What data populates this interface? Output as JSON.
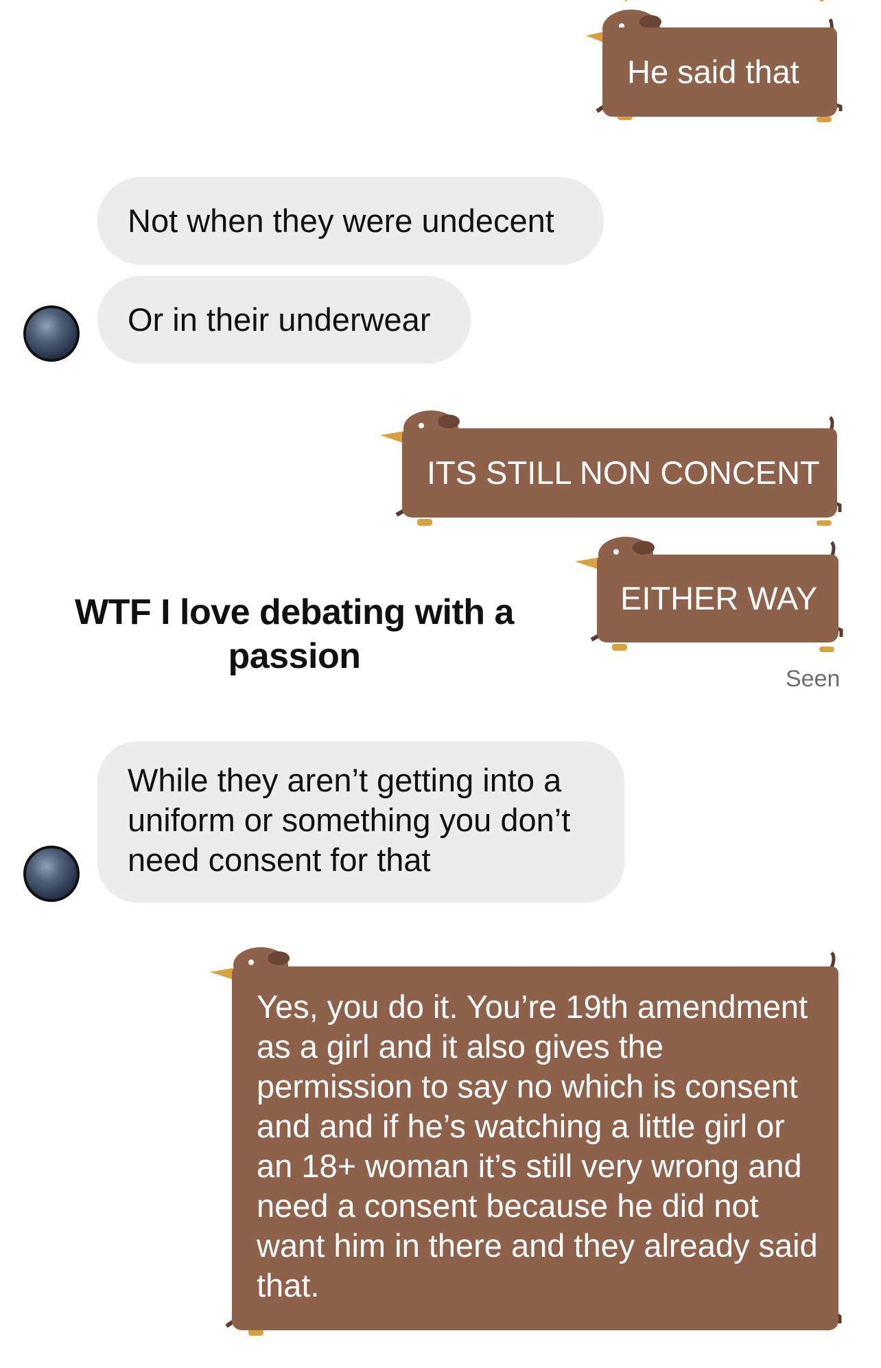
{
  "messages": {
    "m1": "He said that",
    "m2": "Not when they were undecent",
    "m3": "Or in their underwear",
    "m4": "ITS STILL NON CONCENT",
    "m5": "EITHER WAY",
    "m6": "While they aren’t getting into a uniform or something you don’t need consent for that",
    "m7": "Yes, you do it. You’re 19th amendment as a girl and it also gives the permission to say no which is consent and and if he’s watching a little girl or an 18+ woman it’s still very wrong and need a consent because he did not want him in there and they already said that."
  },
  "status": {
    "seen": "Seen"
  },
  "overlay": {
    "caption": "WTF  I love debating with a passion"
  },
  "colors": {
    "incoming_bubble": "#ececec",
    "outgoing_dog": "#8d614a",
    "dog_snout": "#d9a23e",
    "background": "#ffffff"
  },
  "icons": {
    "outgoing_bubble": "dachshund-bubble-icon",
    "sender_avatar": "avatar-icon"
  }
}
